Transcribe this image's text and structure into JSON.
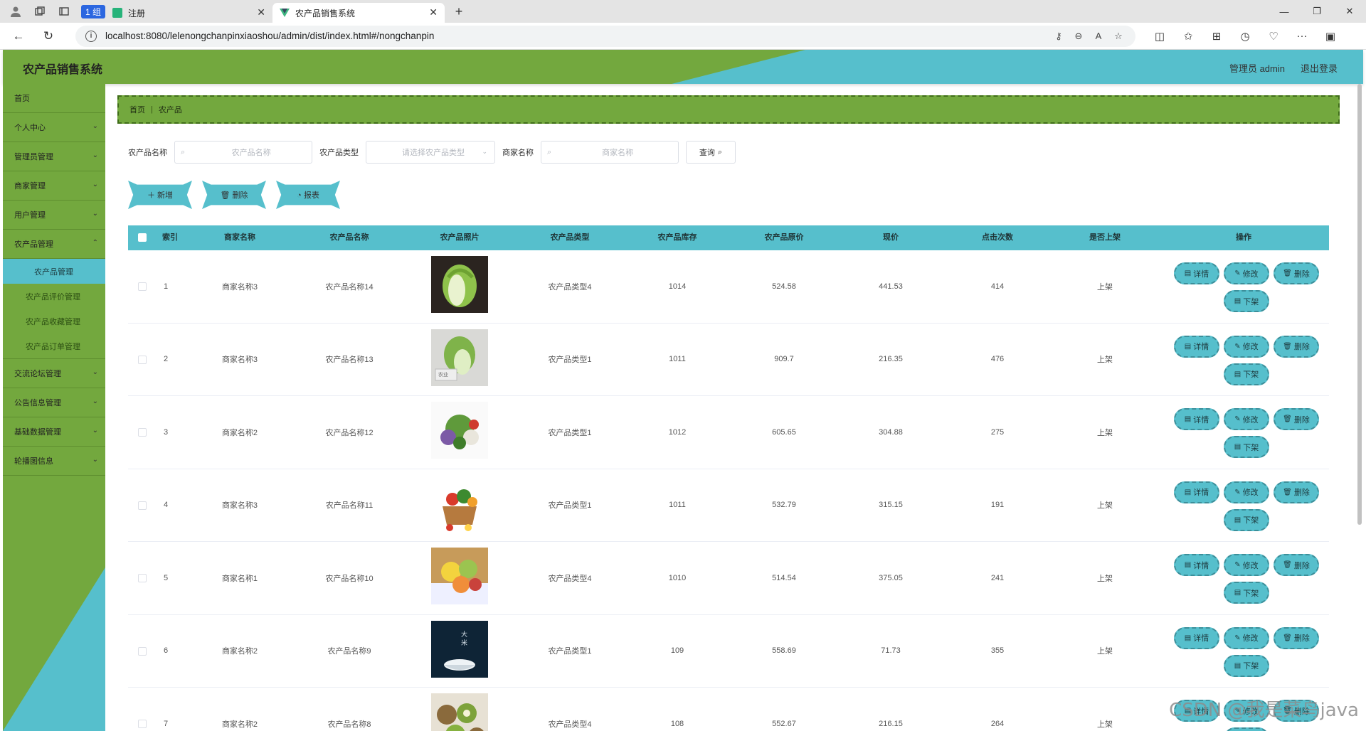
{
  "browser": {
    "tab_group_label": "1 组",
    "tabs": [
      {
        "title": "注册",
        "active": false
      },
      {
        "title": "农产品销售系统",
        "active": true
      }
    ],
    "url": "localhost:8080/lelenongchanpinxiaoshou/admin/dist/index.html#/nongchanpin"
  },
  "header": {
    "title": "农产品销售系统",
    "user": "管理员 admin",
    "logout": "退出登录",
    "colors": {
      "green": "#73a83e",
      "teal": "#56bfcc"
    }
  },
  "sidebar": {
    "items": [
      {
        "label": "首页",
        "has_children": false
      },
      {
        "label": "个人中心",
        "has_children": true
      },
      {
        "label": "管理员管理",
        "has_children": true
      },
      {
        "label": "商家管理",
        "has_children": true
      },
      {
        "label": "用户管理",
        "has_children": true
      },
      {
        "label": "农产品管理",
        "has_children": true,
        "expanded": true
      },
      {
        "label": "交流论坛管理",
        "has_children": true
      },
      {
        "label": "公告信息管理",
        "has_children": true
      },
      {
        "label": "基础数据管理",
        "has_children": true
      },
      {
        "label": "轮播图信息",
        "has_children": true
      }
    ],
    "sub_items": [
      "农产品管理",
      "农产品评价管理",
      "农产品收藏管理",
      "农产品订单管理"
    ]
  },
  "breadcrumb": {
    "home": "首页",
    "current": "农产品"
  },
  "search": {
    "name_label": "农产品名称",
    "name_placeholder": "农产品名称",
    "type_label": "农产品类型",
    "type_placeholder": "请选择农产品类型",
    "merchant_label": "商家名称",
    "merchant_placeholder": "商家名称",
    "query_label": "查询"
  },
  "actions": {
    "add": "新增",
    "delete": "删除",
    "report": "报表"
  },
  "table": {
    "columns": [
      "索引",
      "商家名称",
      "农产品名称",
      "农产品照片",
      "农产品类型",
      "农产品库存",
      "农产品原价",
      "现价",
      "点击次数",
      "是否上架",
      "操作"
    ],
    "op_labels": {
      "detail": "详情",
      "edit": "修改",
      "delete": "删除",
      "offshelf": "下架"
    },
    "rows": [
      {
        "index": "1",
        "merchant": "商家名称3",
        "name": "农产品名称14",
        "photo": "cabbage",
        "type": "农产品类型4",
        "stock": "1014",
        "orig_price": "524.58",
        "price": "441.53",
        "clicks": "414",
        "on_shelf": "上架"
      },
      {
        "index": "2",
        "merchant": "商家名称3",
        "name": "农产品名称13",
        "photo": "napa-cabbage",
        "type": "农产品类型1",
        "stock": "1011",
        "orig_price": "909.7",
        "price": "216.35",
        "clicks": "476",
        "on_shelf": "上架"
      },
      {
        "index": "3",
        "merchant": "商家名称2",
        "name": "农产品名称12",
        "photo": "vegetables",
        "type": "农产品类型1",
        "stock": "1012",
        "orig_price": "605.65",
        "price": "304.88",
        "clicks": "275",
        "on_shelf": "上架"
      },
      {
        "index": "4",
        "merchant": "商家名称3",
        "name": "农产品名称11",
        "photo": "vegetable-basket",
        "type": "农产品类型1",
        "stock": "1011",
        "orig_price": "532.79",
        "price": "315.15",
        "clicks": "191",
        "on_shelf": "上架"
      },
      {
        "index": "5",
        "merchant": "商家名称1",
        "name": "农产品名称10",
        "photo": "fruit-basket",
        "type": "农产品类型4",
        "stock": "1010",
        "orig_price": "514.54",
        "price": "375.05",
        "clicks": "241",
        "on_shelf": "上架"
      },
      {
        "index": "6",
        "merchant": "商家名称2",
        "name": "农产品名称9",
        "photo": "rice-bowl",
        "type": "农产品类型1",
        "stock": "109",
        "orig_price": "558.69",
        "price": "71.73",
        "clicks": "355",
        "on_shelf": "上架"
      },
      {
        "index": "7",
        "merchant": "商家名称2",
        "name": "农产品名称8",
        "photo": "kiwi",
        "type": "农产品类型4",
        "stock": "108",
        "orig_price": "552.67",
        "price": "216.15",
        "clicks": "264",
        "on_shelf": "上架"
      }
    ]
  },
  "watermark": "CSDN @我是菜鸟java"
}
